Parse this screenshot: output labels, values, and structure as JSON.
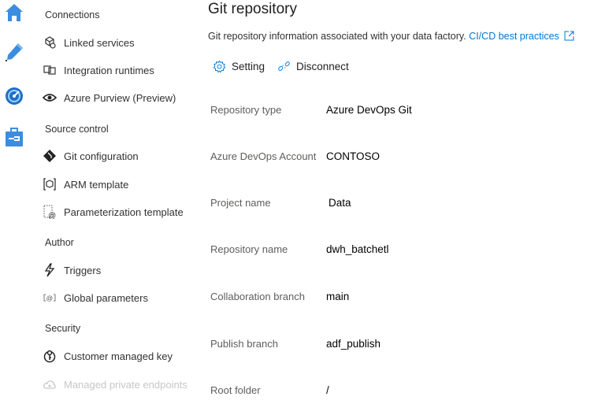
{
  "rail": {
    "icons": [
      "home-icon",
      "pencil-icon",
      "monitor-icon",
      "toolbox-icon"
    ]
  },
  "nav": {
    "sections": [
      {
        "title": "Connections",
        "items": [
          {
            "label": "Linked services",
            "icon": "linked-services-icon"
          },
          {
            "label": "Integration runtimes",
            "icon": "integration-runtimes-icon"
          },
          {
            "label": "Azure Purview (Preview)",
            "icon": "eye-icon"
          }
        ]
      },
      {
        "title": "Source control",
        "items": [
          {
            "label": "Git configuration",
            "icon": "git-icon"
          },
          {
            "label": "ARM template",
            "icon": "arm-template-icon"
          },
          {
            "label": "Parameterization template",
            "icon": "parameterization-icon"
          }
        ]
      },
      {
        "title": "Author",
        "items": [
          {
            "label": "Triggers",
            "icon": "lightning-icon"
          },
          {
            "label": "Global parameters",
            "icon": "global-parameters-icon"
          }
        ]
      },
      {
        "title": "Security",
        "items": [
          {
            "label": "Customer managed key",
            "icon": "key-icon"
          },
          {
            "label": "Managed private endpoints",
            "icon": "cloud-icon",
            "disabled": true
          }
        ]
      }
    ]
  },
  "main": {
    "title": "Git repository",
    "description": "Git repository information associated with your data factory.",
    "link_label": "CI/CD best practices",
    "toolbar": {
      "setting_label": "Setting",
      "disconnect_label": "Disconnect"
    },
    "fields": [
      {
        "label": "Repository type",
        "value": "Azure DevOps Git"
      },
      {
        "label": "Azure DevOps Account",
        "value": "CONTOSO"
      },
      {
        "label": "Project name",
        "value": "Data"
      },
      {
        "label": "Repository name",
        "value": "dwh_batchetl"
      },
      {
        "label": "Collaboration branch",
        "value": "main"
      },
      {
        "label": "Publish branch",
        "value": "adf_publish"
      },
      {
        "label": "Root folder",
        "value": "/"
      }
    ]
  },
  "colors": {
    "accent": "#0078d4",
    "rail_icon": "#3b8de0",
    "disabled_text": "#c8c6c4"
  }
}
